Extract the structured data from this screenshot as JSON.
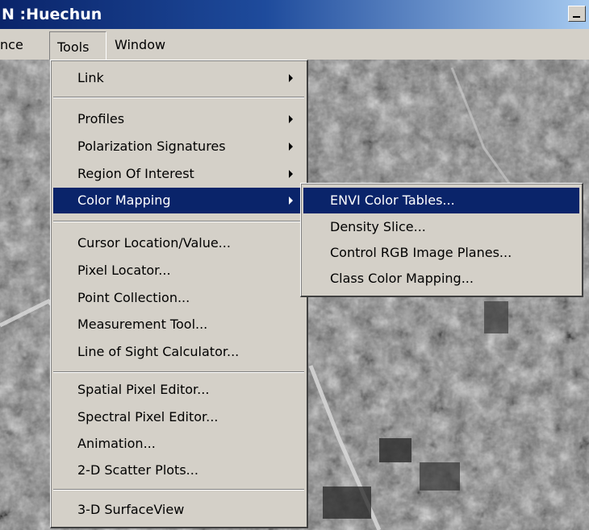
{
  "window": {
    "title": "N :Huechun"
  },
  "menubar": {
    "items": [
      {
        "label": "nce"
      },
      {
        "label": "Tools"
      },
      {
        "label": "Window"
      }
    ]
  },
  "tools_menu": {
    "items": [
      {
        "label": "Link",
        "submenu": true
      },
      {
        "label": "Profiles",
        "submenu": true
      },
      {
        "label": "Polarization Signatures",
        "submenu": true
      },
      {
        "label": "Region Of Interest",
        "submenu": true
      },
      {
        "label": "Color Mapping",
        "submenu": true,
        "highlighted": true
      },
      {
        "label": "Cursor Location/Value..."
      },
      {
        "label": "Pixel Locator..."
      },
      {
        "label": "Point Collection..."
      },
      {
        "label": "Measurement Tool..."
      },
      {
        "label": "Line of Sight Calculator..."
      },
      {
        "label": "Spatial Pixel Editor..."
      },
      {
        "label": "Spectral Pixel Editor..."
      },
      {
        "label": "Animation..."
      },
      {
        "label": "2-D Scatter Plots..."
      },
      {
        "label": "3-D SurfaceView"
      }
    ]
  },
  "color_mapping_submenu": {
    "items": [
      {
        "label": "ENVI Color Tables...",
        "highlighted": true
      },
      {
        "label": "Density Slice..."
      },
      {
        "label": "Control RGB Image Planes..."
      },
      {
        "label": "Class Color Mapping..."
      }
    ]
  },
  "colors": {
    "highlight": "#0a246a",
    "menu_bg": "#d4d0c8",
    "title_bar": "#0a246a"
  }
}
